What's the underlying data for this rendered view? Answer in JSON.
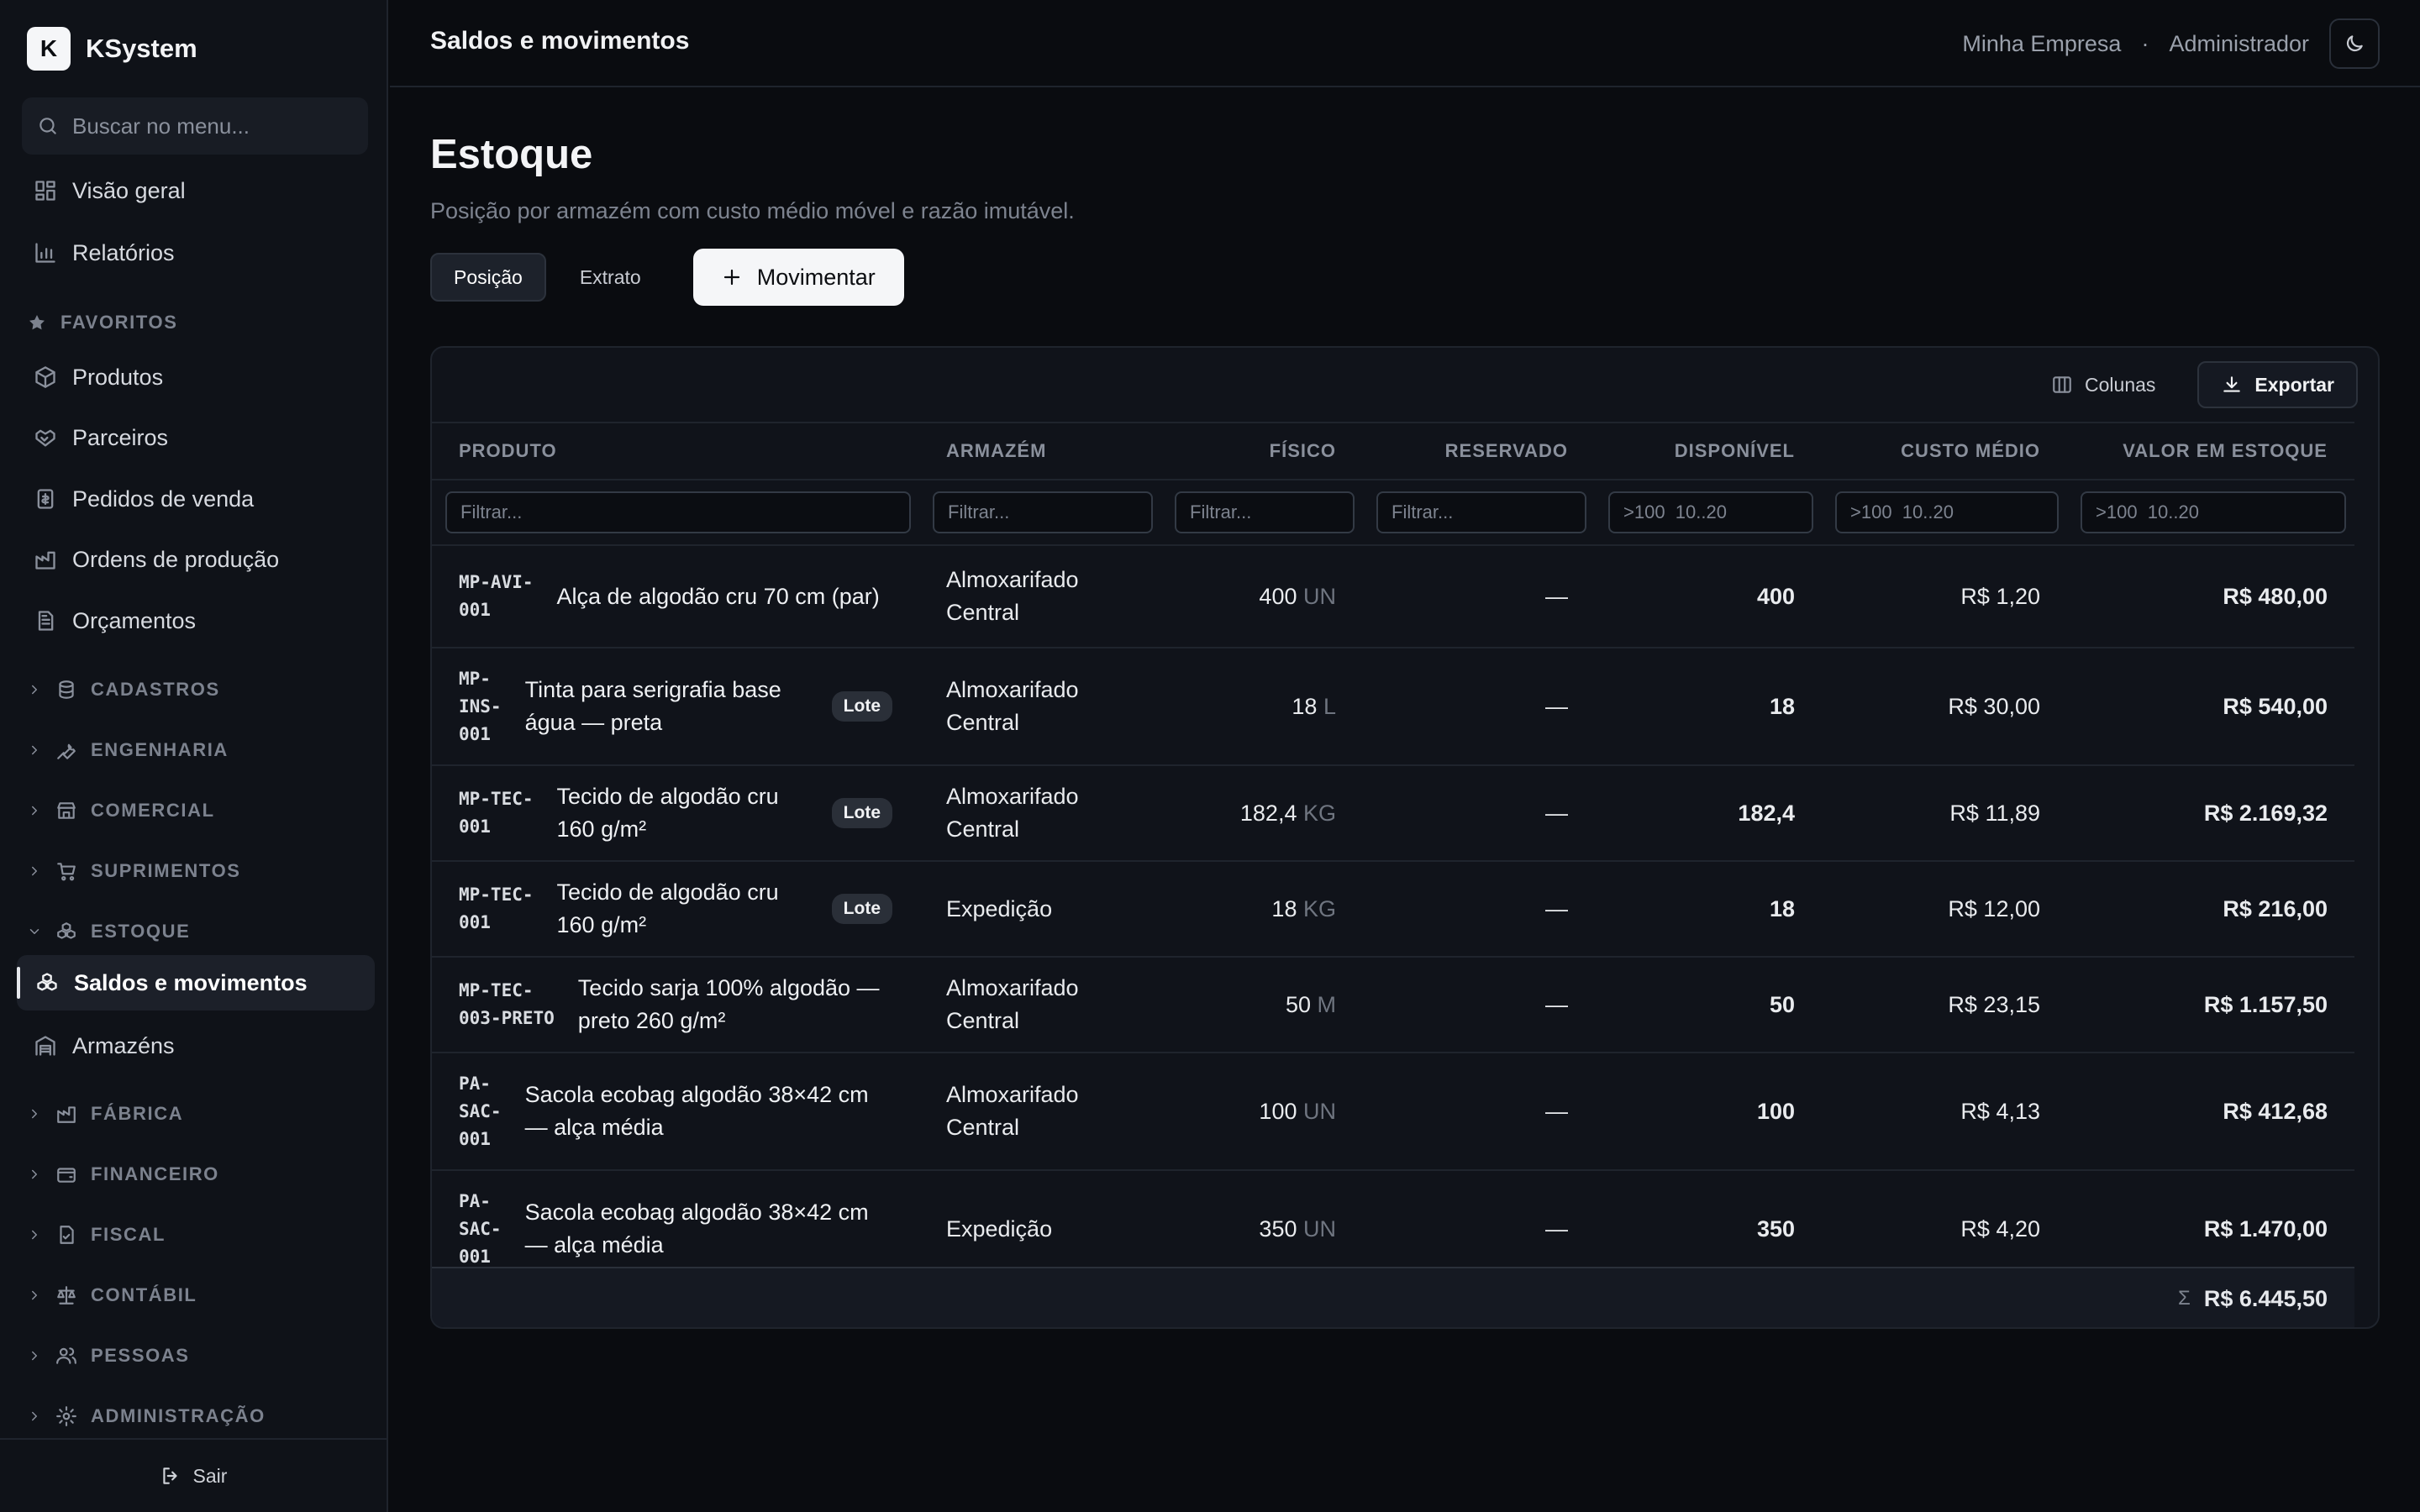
{
  "app": {
    "name": "KSystem",
    "logo_letter": "K"
  },
  "sidebar": {
    "search_placeholder": "Buscar no menu...",
    "top_items": [
      {
        "label": "Visão geral",
        "icon": "dashboard-icon"
      },
      {
        "label": "Relatórios",
        "icon": "bar-chart-icon"
      }
    ],
    "favorites_label": "FAVORITOS",
    "favorites": [
      {
        "label": "Produtos",
        "icon": "box-icon"
      },
      {
        "label": "Parceiros",
        "icon": "handshake-icon"
      },
      {
        "label": "Pedidos de venda",
        "icon": "receipt-icon"
      },
      {
        "label": "Ordens de produção",
        "icon": "factory-icon"
      },
      {
        "label": "Orçamentos",
        "icon": "document-icon"
      }
    ],
    "sections": [
      {
        "label": "CADASTROS",
        "icon": "database-icon"
      },
      {
        "label": "ENGENHARIA",
        "icon": "wrench-icon"
      },
      {
        "label": "COMERCIAL",
        "icon": "store-icon"
      },
      {
        "label": "SUPRIMENTOS",
        "icon": "cart-icon"
      },
      {
        "label": "ESTOQUE",
        "icon": "boxes-icon",
        "expanded": true
      },
      {
        "label": "FÁBRICA",
        "icon": "factory-icon"
      },
      {
        "label": "FINANCEIRO",
        "icon": "wallet-icon"
      },
      {
        "label": "FISCAL",
        "icon": "file-check-icon"
      },
      {
        "label": "CONTÁBIL",
        "icon": "scale-icon"
      },
      {
        "label": "PESSOAS",
        "icon": "users-icon"
      },
      {
        "label": "ADMINISTRAÇÃO",
        "icon": "gear-icon"
      }
    ],
    "estoque_items": [
      {
        "label": "Saldos e movimentos",
        "icon": "boxes-icon",
        "active": true
      },
      {
        "label": "Armazéns",
        "icon": "warehouse-icon"
      }
    ],
    "logout_label": "Sair"
  },
  "topbar": {
    "title": "Saldos e movimentos",
    "company": "Minha Empresa",
    "separator": "·",
    "user": "Administrador"
  },
  "page": {
    "title": "Estoque",
    "subtitle": "Posição por armazém com custo médio móvel e razão imutável.",
    "tabs": [
      {
        "label": "Posição",
        "active": true
      },
      {
        "label": "Extrato"
      }
    ],
    "primary_action": "Movimentar"
  },
  "toolbar": {
    "columns_label": "Colunas",
    "export_label": "Exportar"
  },
  "table": {
    "columns": [
      "PRODUTO",
      "ARMAZÉM",
      "FÍSICO",
      "RESERVADO",
      "DISPONÍVEL",
      "CUSTO MÉDIO",
      "VALOR EM ESTOQUE"
    ],
    "filters": [
      "Filtrar...",
      "Filtrar...",
      "Filtrar...",
      "Filtrar...",
      ">100  10..20",
      ">100  10..20",
      ">100  10..20"
    ],
    "rows": [
      {
        "code": "MP-AVI-\n001",
        "name": "Alça de algodão cru 70 cm (par)",
        "lote": "",
        "warehouse": "Almoxarifado Central",
        "physical": "400",
        "unit": "UN",
        "reserved": "—",
        "available": "400",
        "avg_cost": "R$ 1,20",
        "value": "R$ 480,00"
      },
      {
        "code": "MP-\nINS-\n001",
        "name": "Tinta para serigrafia base água — preta",
        "lote": "Lote",
        "warehouse": "Almoxarifado Central",
        "physical": "18",
        "unit": "L",
        "reserved": "—",
        "available": "18",
        "avg_cost": "R$ 30,00",
        "value": "R$ 540,00"
      },
      {
        "code": "MP-TEC-\n001",
        "name": "Tecido de algodão cru 160 g/m²",
        "lote": "Lote",
        "warehouse": "Almoxarifado Central",
        "physical": "182,4",
        "unit": "KG",
        "reserved": "—",
        "available": "182,4",
        "avg_cost": "R$ 11,89",
        "value": "R$ 2.169,32"
      },
      {
        "code": "MP-TEC-\n001",
        "name": "Tecido de algodão cru 160 g/m²",
        "lote": "Lote",
        "warehouse": "Expedição",
        "physical": "18",
        "unit": "KG",
        "reserved": "—",
        "available": "18",
        "avg_cost": "R$ 12,00",
        "value": "R$ 216,00"
      },
      {
        "code": "MP-TEC-\n003-PRETO",
        "name": "Tecido sarja 100% algodão — preto 260 g/m²",
        "lote": "",
        "warehouse": "Almoxarifado Central",
        "physical": "50",
        "unit": "M",
        "reserved": "—",
        "available": "50",
        "avg_cost": "R$ 23,15",
        "value": "R$ 1.157,50"
      },
      {
        "code": "PA-\nSAC-\n001",
        "name": "Sacola ecobag algodão 38×42 cm — alça média",
        "lote": "",
        "warehouse": "Almoxarifado Central",
        "physical": "100",
        "unit": "UN",
        "reserved": "—",
        "available": "100",
        "avg_cost": "R$ 4,13",
        "value": "R$ 412,68"
      },
      {
        "code": "PA-\nSAC-\n001",
        "name": "Sacola ecobag algodão 38×42 cm — alça média",
        "lote": "",
        "warehouse": "Expedição",
        "physical": "350",
        "unit": "UN",
        "reserved": "—",
        "available": "350",
        "avg_cost": "R$ 4,20",
        "value": "R$ 1.470,00"
      }
    ],
    "total_symbol": "Σ",
    "total": "R$ 6.445,50"
  }
}
